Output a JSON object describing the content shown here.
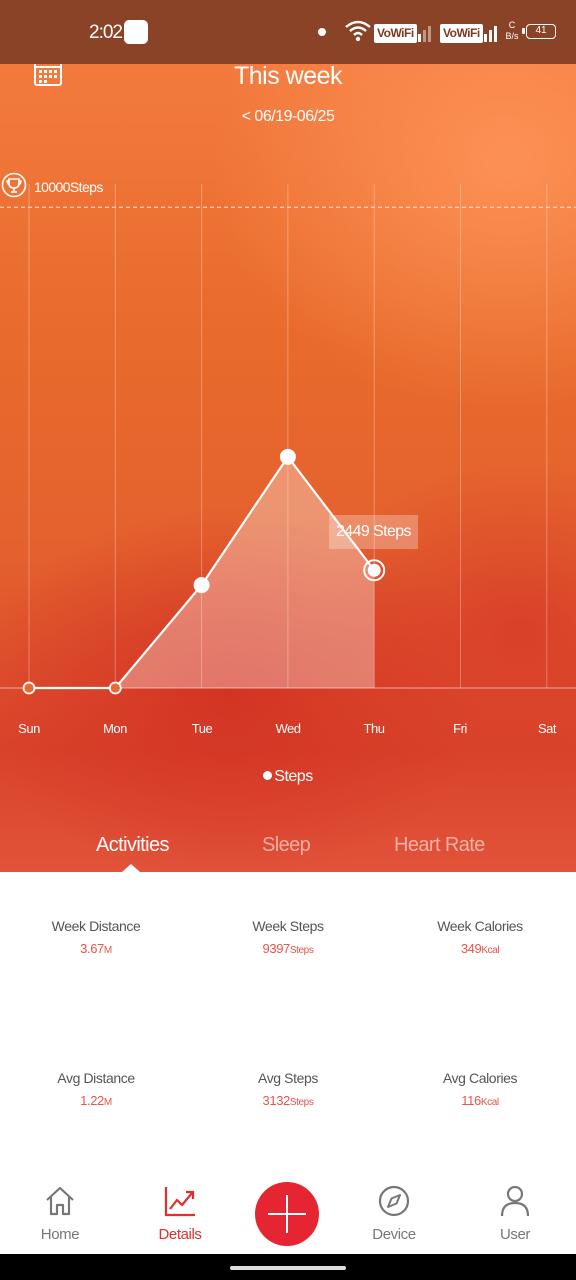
{
  "status_bar": {
    "time": "2:02",
    "network_1": "VoWiFi",
    "network_2": "VoWiFi",
    "speed_top": "C",
    "speed_bottom": "B/s",
    "battery": "41"
  },
  "header": {
    "title": "This week",
    "date_range": "< 06/19-06/25"
  },
  "goal": {
    "label": "10000Steps"
  },
  "tooltip": "2449 Steps",
  "legend": {
    "label": "Steps"
  },
  "chart_data": {
    "type": "area",
    "categories": [
      "Sun",
      "Mon",
      "Tue",
      "Wed",
      "Thu",
      "Fri",
      "Sat"
    ],
    "series": [
      {
        "name": "Steps",
        "values": [
          0,
          0,
          2140,
          4808,
          2449,
          null,
          null
        ]
      }
    ],
    "goal": 10000,
    "ylim": [
      0,
      10400
    ],
    "selected_index": 4
  },
  "tabs": [
    {
      "label": "Activities",
      "active": true
    },
    {
      "label": "Sleep",
      "active": false
    },
    {
      "label": "Heart Rate",
      "active": false
    }
  ],
  "stats": {
    "week_distance": {
      "label": "Week Distance",
      "value": "3.67",
      "unit": "M"
    },
    "week_steps": {
      "label": "Week Steps",
      "value": "9397",
      "unit": "Steps"
    },
    "week_calories": {
      "label": "Week Calories",
      "value": "349",
      "unit": "Kcal"
    },
    "avg_distance": {
      "label": "Avg Distance",
      "value": "1.22",
      "unit": "M"
    },
    "avg_steps": {
      "label": "Avg Steps",
      "value": "3132",
      "unit": "Steps"
    },
    "avg_calories": {
      "label": "Avg Calories",
      "value": "116",
      "unit": "Kcal"
    }
  },
  "nav": {
    "home": "Home",
    "details": "Details",
    "device": "Device",
    "user": "User"
  },
  "colors": {
    "accent": "#e52531",
    "value_text": "#e8544a",
    "status_bar": "#8a4326"
  }
}
